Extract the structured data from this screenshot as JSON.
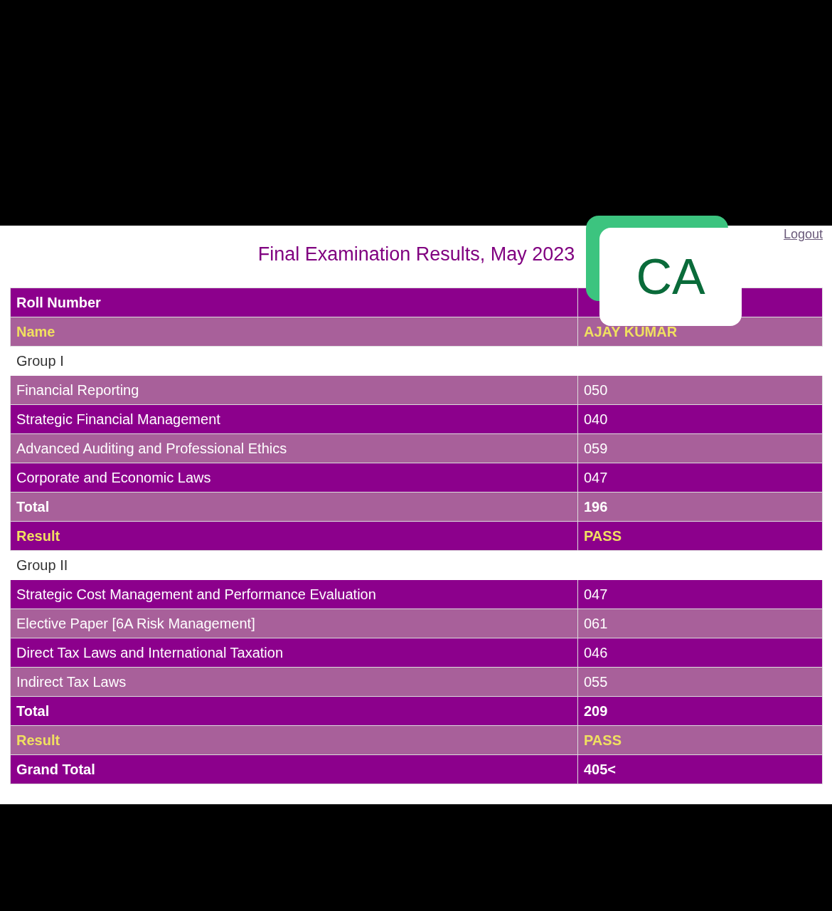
{
  "logout_link": "Logout",
  "title": "Final Examination Results, May 2023",
  "badge": "CA",
  "rows": [
    {
      "kind": "bold",
      "label": "Roll Number"
    },
    {
      "kind": "highlight",
      "label": "Name",
      "value": "AJAY KUMAR"
    },
    {
      "kind": "group",
      "label": "Group I"
    },
    {
      "kind": "plain",
      "label": "Financial Reporting",
      "value": "050"
    },
    {
      "kind": "plain",
      "label": "Strategic Financial Management",
      "value": "040"
    },
    {
      "kind": "plain",
      "label": "Advanced Auditing and Professional Ethics",
      "value": "059"
    },
    {
      "kind": "plain",
      "label": "Corporate and Economic Laws",
      "value": "047"
    },
    {
      "kind": "bold",
      "label": "Total",
      "value": "196"
    },
    {
      "kind": "highlight",
      "label": "Result",
      "value": "PASS"
    },
    {
      "kind": "group",
      "label": "Group II"
    },
    {
      "kind": "plain",
      "label": "Strategic Cost Management and Performance Evaluation",
      "value": "047"
    },
    {
      "kind": "plain",
      "label": "Elective Paper [6A Risk Management]",
      "value": "061"
    },
    {
      "kind": "plain",
      "label": "Direct Tax Laws and International Taxation",
      "value": "046"
    },
    {
      "kind": "plain",
      "label": "Indirect Tax Laws",
      "value": "055"
    },
    {
      "kind": "bold",
      "label": "Total",
      "value": "209"
    },
    {
      "kind": "highlight",
      "label": "Result",
      "value": "PASS"
    },
    {
      "kind": "bold",
      "label": "Grand Total",
      "value": "405<"
    }
  ]
}
